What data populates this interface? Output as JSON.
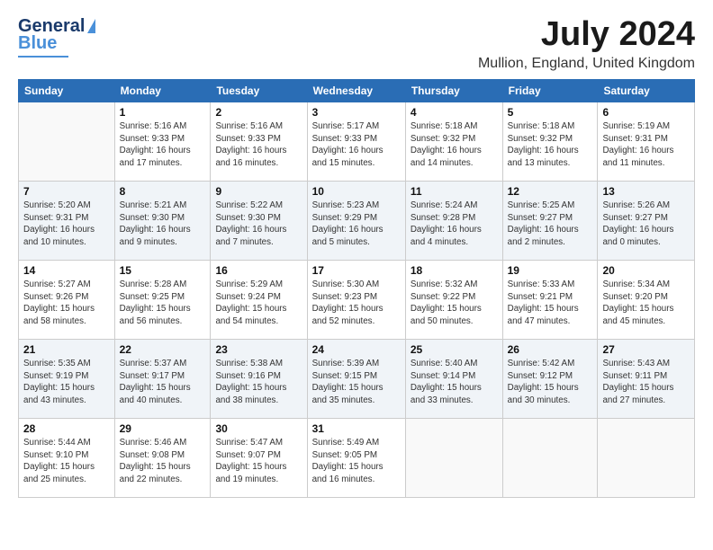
{
  "header": {
    "logo_line1": "General",
    "logo_line2": "Blue",
    "main_title": "July 2024",
    "subtitle": "Mullion, England, United Kingdom"
  },
  "days_of_week": [
    "Sunday",
    "Monday",
    "Tuesday",
    "Wednesday",
    "Thursday",
    "Friday",
    "Saturday"
  ],
  "weeks": [
    [
      {
        "day": "",
        "info": ""
      },
      {
        "day": "1",
        "info": "Sunrise: 5:16 AM\nSunset: 9:33 PM\nDaylight: 16 hours\nand 17 minutes."
      },
      {
        "day": "2",
        "info": "Sunrise: 5:16 AM\nSunset: 9:33 PM\nDaylight: 16 hours\nand 16 minutes."
      },
      {
        "day": "3",
        "info": "Sunrise: 5:17 AM\nSunset: 9:33 PM\nDaylight: 16 hours\nand 15 minutes."
      },
      {
        "day": "4",
        "info": "Sunrise: 5:18 AM\nSunset: 9:32 PM\nDaylight: 16 hours\nand 14 minutes."
      },
      {
        "day": "5",
        "info": "Sunrise: 5:18 AM\nSunset: 9:32 PM\nDaylight: 16 hours\nand 13 minutes."
      },
      {
        "day": "6",
        "info": "Sunrise: 5:19 AM\nSunset: 9:31 PM\nDaylight: 16 hours\nand 11 minutes."
      }
    ],
    [
      {
        "day": "7",
        "info": "Sunrise: 5:20 AM\nSunset: 9:31 PM\nDaylight: 16 hours\nand 10 minutes."
      },
      {
        "day": "8",
        "info": "Sunrise: 5:21 AM\nSunset: 9:30 PM\nDaylight: 16 hours\nand 9 minutes."
      },
      {
        "day": "9",
        "info": "Sunrise: 5:22 AM\nSunset: 9:30 PM\nDaylight: 16 hours\nand 7 minutes."
      },
      {
        "day": "10",
        "info": "Sunrise: 5:23 AM\nSunset: 9:29 PM\nDaylight: 16 hours\nand 5 minutes."
      },
      {
        "day": "11",
        "info": "Sunrise: 5:24 AM\nSunset: 9:28 PM\nDaylight: 16 hours\nand 4 minutes."
      },
      {
        "day": "12",
        "info": "Sunrise: 5:25 AM\nSunset: 9:27 PM\nDaylight: 16 hours\nand 2 minutes."
      },
      {
        "day": "13",
        "info": "Sunrise: 5:26 AM\nSunset: 9:27 PM\nDaylight: 16 hours\nand 0 minutes."
      }
    ],
    [
      {
        "day": "14",
        "info": "Sunrise: 5:27 AM\nSunset: 9:26 PM\nDaylight: 15 hours\nand 58 minutes."
      },
      {
        "day": "15",
        "info": "Sunrise: 5:28 AM\nSunset: 9:25 PM\nDaylight: 15 hours\nand 56 minutes."
      },
      {
        "day": "16",
        "info": "Sunrise: 5:29 AM\nSunset: 9:24 PM\nDaylight: 15 hours\nand 54 minutes."
      },
      {
        "day": "17",
        "info": "Sunrise: 5:30 AM\nSunset: 9:23 PM\nDaylight: 15 hours\nand 52 minutes."
      },
      {
        "day": "18",
        "info": "Sunrise: 5:32 AM\nSunset: 9:22 PM\nDaylight: 15 hours\nand 50 minutes."
      },
      {
        "day": "19",
        "info": "Sunrise: 5:33 AM\nSunset: 9:21 PM\nDaylight: 15 hours\nand 47 minutes."
      },
      {
        "day": "20",
        "info": "Sunrise: 5:34 AM\nSunset: 9:20 PM\nDaylight: 15 hours\nand 45 minutes."
      }
    ],
    [
      {
        "day": "21",
        "info": "Sunrise: 5:35 AM\nSunset: 9:19 PM\nDaylight: 15 hours\nand 43 minutes."
      },
      {
        "day": "22",
        "info": "Sunrise: 5:37 AM\nSunset: 9:17 PM\nDaylight: 15 hours\nand 40 minutes."
      },
      {
        "day": "23",
        "info": "Sunrise: 5:38 AM\nSunset: 9:16 PM\nDaylight: 15 hours\nand 38 minutes."
      },
      {
        "day": "24",
        "info": "Sunrise: 5:39 AM\nSunset: 9:15 PM\nDaylight: 15 hours\nand 35 minutes."
      },
      {
        "day": "25",
        "info": "Sunrise: 5:40 AM\nSunset: 9:14 PM\nDaylight: 15 hours\nand 33 minutes."
      },
      {
        "day": "26",
        "info": "Sunrise: 5:42 AM\nSunset: 9:12 PM\nDaylight: 15 hours\nand 30 minutes."
      },
      {
        "day": "27",
        "info": "Sunrise: 5:43 AM\nSunset: 9:11 PM\nDaylight: 15 hours\nand 27 minutes."
      }
    ],
    [
      {
        "day": "28",
        "info": "Sunrise: 5:44 AM\nSunset: 9:10 PM\nDaylight: 15 hours\nand 25 minutes."
      },
      {
        "day": "29",
        "info": "Sunrise: 5:46 AM\nSunset: 9:08 PM\nDaylight: 15 hours\nand 22 minutes."
      },
      {
        "day": "30",
        "info": "Sunrise: 5:47 AM\nSunset: 9:07 PM\nDaylight: 15 hours\nand 19 minutes."
      },
      {
        "day": "31",
        "info": "Sunrise: 5:49 AM\nSunset: 9:05 PM\nDaylight: 15 hours\nand 16 minutes."
      },
      {
        "day": "",
        "info": ""
      },
      {
        "day": "",
        "info": ""
      },
      {
        "day": "",
        "info": ""
      }
    ]
  ]
}
